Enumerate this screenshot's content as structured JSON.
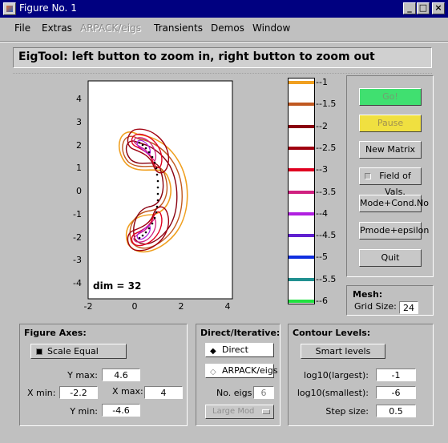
{
  "window": {
    "title": "Figure No. 1"
  },
  "menu": [
    "File",
    "Extras",
    "ARPACK/eigs",
    "Transients",
    "Demos",
    "Window"
  ],
  "header": {
    "text": "EigTool: left button to zoom in, right button to zoom out"
  },
  "plot": {
    "annotation": "dim = 32",
    "x_ticks": [
      "-2",
      "0",
      "2",
      "4"
    ],
    "y_ticks": [
      "4",
      "3",
      "2",
      "1",
      "0",
      "-1",
      "-2",
      "-3",
      "-4"
    ]
  },
  "colorbar": {
    "levels": [
      "-1",
      "-1.5",
      "-2",
      "-2.5",
      "-3",
      "-3.5",
      "-4",
      "-4.5",
      "-5",
      "-5.5",
      "-6"
    ],
    "colors": [
      "#f0a020",
      "#c05820",
      "#8a0010",
      "#a00010",
      "#e00020",
      "#d02080",
      "#b020e0",
      "#6020d0",
      "#1030e0",
      "#209090",
      "#20e040"
    ]
  },
  "right_buttons": {
    "go": "Go!",
    "pause": "Pause",
    "new_matrix": "New Matrix",
    "field_of_vals": "Field of Vals.",
    "mode_cond": "Mode+Cond.No",
    "pmode": "Pmode+epsilon",
    "quit": "Quit"
  },
  "mesh": {
    "title": "Mesh:",
    "grid_label": "Grid Size:",
    "grid_value": "24"
  },
  "figure_axes": {
    "title": "Figure Axes:",
    "scale_equal": "Scale Equal",
    "ymax_label": "Y max:",
    "ymax": "4.6",
    "xmin_label": "X min:",
    "xmin": "-2.2",
    "xmax_label": "X max:",
    "xmax": "4",
    "ymin_label": "Y min:",
    "ymin": "-4.6"
  },
  "direct_iterative": {
    "title": "Direct/Iterative:",
    "direct": "Direct",
    "arpack": "ARPACK/eigs",
    "no_eigs_label": "No. eigs",
    "no_eigs": "6",
    "mode_select": "Large Mod"
  },
  "contour_levels": {
    "title": "Contour Levels:",
    "smart": "Smart  levels",
    "largest_label": "log10(largest):",
    "largest": "-1",
    "smallest_label": "log10(smallest):",
    "smallest": "-6",
    "step_label": "Step size:",
    "step": "0.5"
  }
}
